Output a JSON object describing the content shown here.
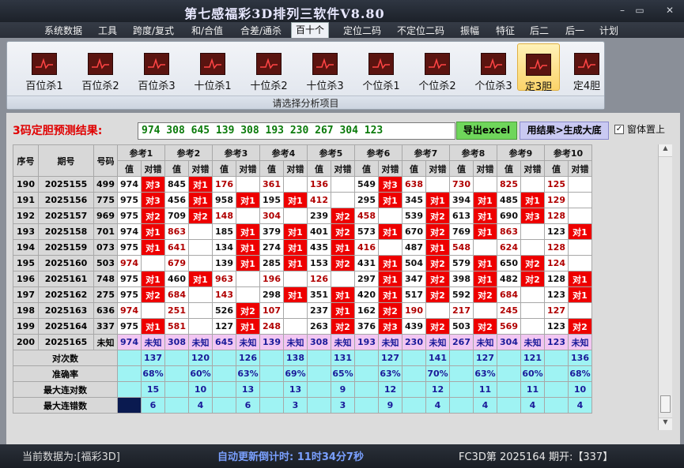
{
  "window": {
    "title": "第七感福彩3D排列三软件V8.80",
    "min": "–",
    "max": "▭",
    "close": "✕"
  },
  "menu": [
    "系统数据",
    "工具",
    "跨度/复式",
    "和/合值",
    "合差/通杀",
    "百十个",
    "定位二码",
    "不定位二码",
    "振幅",
    "特征",
    "后二",
    "后一",
    "计划"
  ],
  "menu_active": 5,
  "toolbar": {
    "items": [
      "百位杀1",
      "百位杀2",
      "百位杀3",
      "十位杀1",
      "十位杀2",
      "十位杀3",
      "个位杀1",
      "个位杀2",
      "个位杀3",
      "定3胆",
      "定4胆"
    ],
    "selected": 9,
    "caption": "请选择分析项目"
  },
  "result": {
    "label": "3码定胆预测结果:",
    "value": "974 308 645 139 308 193 230 267 304 123",
    "export_label": "导出excel",
    "gen_label": "用结果>生成大底",
    "ontop_label": "窗体置上",
    "ontop_checked": "✓"
  },
  "colors": {
    "miss": "#b00000",
    "mark": "#ee0000",
    "predict": "#f2c6f2",
    "stats": "#9ff3f3"
  },
  "table": {
    "col_headers": [
      "序号",
      "期号",
      "号码"
    ],
    "ref_headers": [
      "参考1",
      "参考2",
      "参考3",
      "参考4",
      "参考5",
      "参考6",
      "参考7",
      "参考8",
      "参考9",
      "参考10"
    ],
    "sub_value": "值",
    "sub_check": "对错",
    "rows": [
      {
        "seq": "190",
        "issue": "2025155",
        "num": "499",
        "c": [
          [
            "974",
            "对3",
            1
          ],
          [
            "845",
            "对1",
            1
          ],
          [
            "176",
            "",
            0
          ],
          [
            "361",
            "",
            0
          ],
          [
            "136",
            "",
            0
          ],
          [
            "549",
            "对3",
            1
          ],
          [
            "638",
            "",
            0
          ],
          [
            "730",
            "",
            0
          ],
          [
            "825",
            "",
            0
          ],
          [
            "125",
            "",
            0
          ]
        ]
      },
      {
        "seq": "191",
        "issue": "2025156",
        "num": "775",
        "c": [
          [
            "975",
            "对3",
            1
          ],
          [
            "456",
            "对1",
            1
          ],
          [
            "958",
            "对1",
            1
          ],
          [
            "195",
            "对1",
            1
          ],
          [
            "412",
            "",
            0
          ],
          [
            "295",
            "对1",
            1
          ],
          [
            "345",
            "对1",
            1
          ],
          [
            "394",
            "对1",
            1
          ],
          [
            "485",
            "对1",
            1
          ],
          [
            "129",
            "",
            0
          ]
        ]
      },
      {
        "seq": "192",
        "issue": "2025157",
        "num": "969",
        "c": [
          [
            "975",
            "对2",
            1
          ],
          [
            "709",
            "对2",
            1
          ],
          [
            "148",
            "",
            0
          ],
          [
            "304",
            "",
            0
          ],
          [
            "239",
            "对2",
            1
          ],
          [
            "458",
            "",
            0
          ],
          [
            "539",
            "对2",
            1
          ],
          [
            "613",
            "对1",
            1
          ],
          [
            "690",
            "对3",
            1
          ],
          [
            "128",
            "",
            0
          ]
        ]
      },
      {
        "seq": "193",
        "issue": "2025158",
        "num": "701",
        "c": [
          [
            "974",
            "对1",
            1
          ],
          [
            "863",
            "",
            0
          ],
          [
            "185",
            "对1",
            1
          ],
          [
            "379",
            "对1",
            1
          ],
          [
            "401",
            "对2",
            1
          ],
          [
            "573",
            "对1",
            1
          ],
          [
            "670",
            "对2",
            1
          ],
          [
            "769",
            "对1",
            1
          ],
          [
            "863",
            "",
            0
          ],
          [
            "123",
            "对1",
            1
          ]
        ]
      },
      {
        "seq": "194",
        "issue": "2025159",
        "num": "073",
        "c": [
          [
            "975",
            "对1",
            1
          ],
          [
            "641",
            "",
            0
          ],
          [
            "134",
            "对1",
            1
          ],
          [
            "274",
            "对1",
            1
          ],
          [
            "435",
            "对1",
            1
          ],
          [
            "416",
            "",
            0
          ],
          [
            "487",
            "对1",
            1
          ],
          [
            "548",
            "",
            0
          ],
          [
            "624",
            "",
            0
          ],
          [
            "128",
            "",
            0
          ]
        ]
      },
      {
        "seq": "195",
        "issue": "2025160",
        "num": "503",
        "c": [
          [
            "974",
            "",
            0
          ],
          [
            "679",
            "",
            0
          ],
          [
            "139",
            "对1",
            1
          ],
          [
            "285",
            "对1",
            1
          ],
          [
            "153",
            "对2",
            1
          ],
          [
            "431",
            "对1",
            1
          ],
          [
            "504",
            "对2",
            1
          ],
          [
            "579",
            "对1",
            1
          ],
          [
            "650",
            "对2",
            1
          ],
          [
            "124",
            "",
            0
          ]
        ]
      },
      {
        "seq": "196",
        "issue": "2025161",
        "num": "748",
        "c": [
          [
            "975",
            "对1",
            1
          ],
          [
            "460",
            "对1",
            1
          ],
          [
            "963",
            "",
            0
          ],
          [
            "196",
            "",
            0
          ],
          [
            "126",
            "",
            0
          ],
          [
            "297",
            "对1",
            1
          ],
          [
            "347",
            "对2",
            1
          ],
          [
            "398",
            "对1",
            1
          ],
          [
            "482",
            "对2",
            1
          ],
          [
            "128",
            "对1",
            1
          ]
        ]
      },
      {
        "seq": "197",
        "issue": "2025162",
        "num": "275",
        "c": [
          [
            "975",
            "对2",
            1
          ],
          [
            "684",
            "",
            0
          ],
          [
            "143",
            "",
            0
          ],
          [
            "298",
            "对1",
            1
          ],
          [
            "351",
            "对1",
            1
          ],
          [
            "420",
            "对1",
            1
          ],
          [
            "517",
            "对2",
            1
          ],
          [
            "592",
            "对2",
            1
          ],
          [
            "684",
            "",
            0
          ],
          [
            "123",
            "对1",
            1
          ]
        ]
      },
      {
        "seq": "198",
        "issue": "2025163",
        "num": "636",
        "c": [
          [
            "974",
            "",
            0
          ],
          [
            "251",
            "",
            0
          ],
          [
            "526",
            "对2",
            1
          ],
          [
            "107",
            "",
            0
          ],
          [
            "237",
            "对1",
            1
          ],
          [
            "162",
            "对2",
            1
          ],
          [
            "190",
            "",
            0
          ],
          [
            "217",
            "",
            0
          ],
          [
            "245",
            "",
            0
          ],
          [
            "127",
            "",
            0
          ]
        ]
      },
      {
        "seq": "199",
        "issue": "2025164",
        "num": "337",
        "c": [
          [
            "975",
            "对1",
            1
          ],
          [
            "581",
            "",
            0
          ],
          [
            "127",
            "对1",
            1
          ],
          [
            "248",
            "",
            0
          ],
          [
            "263",
            "对2",
            1
          ],
          [
            "376",
            "对3",
            1
          ],
          [
            "439",
            "对2",
            1
          ],
          [
            "503",
            "对2",
            1
          ],
          [
            "569",
            "",
            0
          ],
          [
            "123",
            "对2",
            1
          ]
        ]
      }
    ],
    "predict_row": {
      "seq": "200",
      "issue": "2025165",
      "num": "未知",
      "vals": [
        "974",
        "308",
        "645",
        "139",
        "308",
        "193",
        "230",
        "267",
        "304",
        "123"
      ],
      "check": "未知"
    },
    "stats": [
      {
        "label": "对次数",
        "vals": [
          "137",
          "120",
          "126",
          "138",
          "131",
          "127",
          "141",
          "127",
          "121",
          "136"
        ]
      },
      {
        "label": "准确率",
        "vals": [
          "68%",
          "60%",
          "63%",
          "69%",
          "65%",
          "63%",
          "70%",
          "63%",
          "60%",
          "68%"
        ]
      },
      {
        "label": "最大连对数",
        "vals": [
          "15",
          "10",
          "13",
          "13",
          "9",
          "12",
          "12",
          "11",
          "11",
          "10"
        ]
      },
      {
        "label": "最大连错数",
        "vals": [
          "6",
          "4",
          "6",
          "3",
          "3",
          "9",
          "4",
          "4",
          "4",
          "4"
        ]
      }
    ]
  },
  "status": {
    "data": "当前数据为:[福彩3D]",
    "countdown": "自动更新倒计时: 11时34分7秒",
    "period": "FC3D第 2025164 期开:【337】"
  }
}
